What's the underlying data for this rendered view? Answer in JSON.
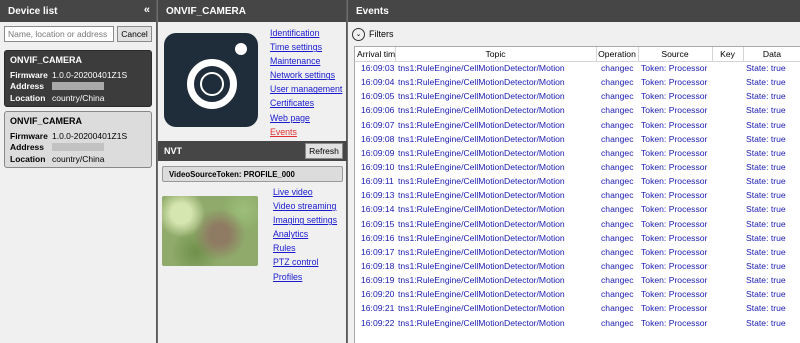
{
  "device_panel": {
    "title": "Device list",
    "collapse_glyph": "«",
    "search_placeholder": "Name, location or address",
    "cancel_label": "Cancel",
    "devices": [
      {
        "name": "ONVIF_CAMERA",
        "firmware_label": "Firmware",
        "firmware": "1.0.0-20200401Z1S",
        "address_label": "Address",
        "location_label": "Location",
        "location": "country/China",
        "selected": true
      },
      {
        "name": "ONVIF_CAMERA",
        "firmware_label": "Firmware",
        "firmware": "1.0.0-20200401Z1S",
        "address_label": "Address",
        "location_label": "Location",
        "location": "country/China",
        "selected": false
      }
    ]
  },
  "device_detail": {
    "title": "ONVIF_CAMERA",
    "logo_icon": "camera-icon",
    "nav_links": [
      "Identification",
      "Time settings",
      "Maintenance",
      "Network settings",
      "User management",
      "Certificates",
      "Web page",
      "Events"
    ],
    "active_link": "Events",
    "nvt_label": "NVT",
    "refresh_label": "Refresh",
    "profile_label": "VideoSourceToken: PROFILE_000",
    "profile_links": [
      "Live video",
      "Video streaming",
      "Imaging settings",
      "Analytics",
      "Rules",
      "PTZ control",
      "Profiles"
    ]
  },
  "events_panel": {
    "title": "Events",
    "filters_label": "Filters",
    "filters_icon": "chevron-down-icon",
    "columns": [
      "Arrival tim",
      "Topic",
      "Operation",
      "Source",
      "Key",
      "Data"
    ],
    "rows": [
      {
        "time": "16:09:03",
        "topic": "tns1:RuleEngine/CellMotionDetector/Motion",
        "operation": "changec",
        "source": "Token: Processor",
        "key": "",
        "data": "State: true"
      },
      {
        "time": "16:09:04",
        "topic": "tns1:RuleEngine/CellMotionDetector/Motion",
        "operation": "changec",
        "source": "Token: Processor",
        "key": "",
        "data": "State: true"
      },
      {
        "time": "16:09:05",
        "topic": "tns1:RuleEngine/CellMotionDetector/Motion",
        "operation": "changec",
        "source": "Token: Processor",
        "key": "",
        "data": "State: true"
      },
      {
        "time": "16:09:06",
        "topic": "tns1:RuleEngine/CellMotionDetector/Motion",
        "operation": "changec",
        "source": "Token: Processor",
        "key": "",
        "data": "State: true"
      },
      {
        "time": "16:09:07",
        "topic": "tns1:RuleEngine/CellMotionDetector/Motion",
        "operation": "changec",
        "source": "Token: Processor",
        "key": "",
        "data": "State: true"
      },
      {
        "time": "16:09:08",
        "topic": "tns1:RuleEngine/CellMotionDetector/Motion",
        "operation": "changec",
        "source": "Token: Processor",
        "key": "",
        "data": "State: true"
      },
      {
        "time": "16:09:09",
        "topic": "tns1:RuleEngine/CellMotionDetector/Motion",
        "operation": "changec",
        "source": "Token: Processor",
        "key": "",
        "data": "State: true"
      },
      {
        "time": "16:09:10",
        "topic": "tns1:RuleEngine/CellMotionDetector/Motion",
        "operation": "changec",
        "source": "Token: Processor",
        "key": "",
        "data": "State: true"
      },
      {
        "time": "16:09:11",
        "topic": "tns1:RuleEngine/CellMotionDetector/Motion",
        "operation": "changec",
        "source": "Token: Processor",
        "key": "",
        "data": "State: true"
      },
      {
        "time": "16:09:13",
        "topic": "tns1:RuleEngine/CellMotionDetector/Motion",
        "operation": "changec",
        "source": "Token: Processor",
        "key": "",
        "data": "State: true"
      },
      {
        "time": "16:09:14",
        "topic": "tns1:RuleEngine/CellMotionDetector/Motion",
        "operation": "changec",
        "source": "Token: Processor",
        "key": "",
        "data": "State: true"
      },
      {
        "time": "16:09:15",
        "topic": "tns1:RuleEngine/CellMotionDetector/Motion",
        "operation": "changec",
        "source": "Token: Processor",
        "key": "",
        "data": "State: true"
      },
      {
        "time": "16:09:16",
        "topic": "tns1:RuleEngine/CellMotionDetector/Motion",
        "operation": "changec",
        "source": "Token: Processor",
        "key": "",
        "data": "State: true"
      },
      {
        "time": "16:09:17",
        "topic": "tns1:RuleEngine/CellMotionDetector/Motion",
        "operation": "changec",
        "source": "Token: Processor",
        "key": "",
        "data": "State: true"
      },
      {
        "time": "16:09:18",
        "topic": "tns1:RuleEngine/CellMotionDetector/Motion",
        "operation": "changec",
        "source": "Token: Processor",
        "key": "",
        "data": "State: true"
      },
      {
        "time": "16:09:19",
        "topic": "tns1:RuleEngine/CellMotionDetector/Motion",
        "operation": "changec",
        "source": "Token: Processor",
        "key": "",
        "data": "State: true"
      },
      {
        "time": "16:09:20",
        "topic": "tns1:RuleEngine/CellMotionDetector/Motion",
        "operation": "changec",
        "source": "Token: Processor",
        "key": "",
        "data": "State: true"
      },
      {
        "time": "16:09:21",
        "topic": "tns1:RuleEngine/CellMotionDetector/Motion",
        "operation": "changec",
        "source": "Token: Processor",
        "key": "",
        "data": "State: true"
      },
      {
        "time": "16:09:22",
        "topic": "tns1:RuleEngine/CellMotionDetector/Motion",
        "operation": "changec",
        "source": "Token: Processor",
        "key": "",
        "data": "State: true"
      }
    ]
  }
}
